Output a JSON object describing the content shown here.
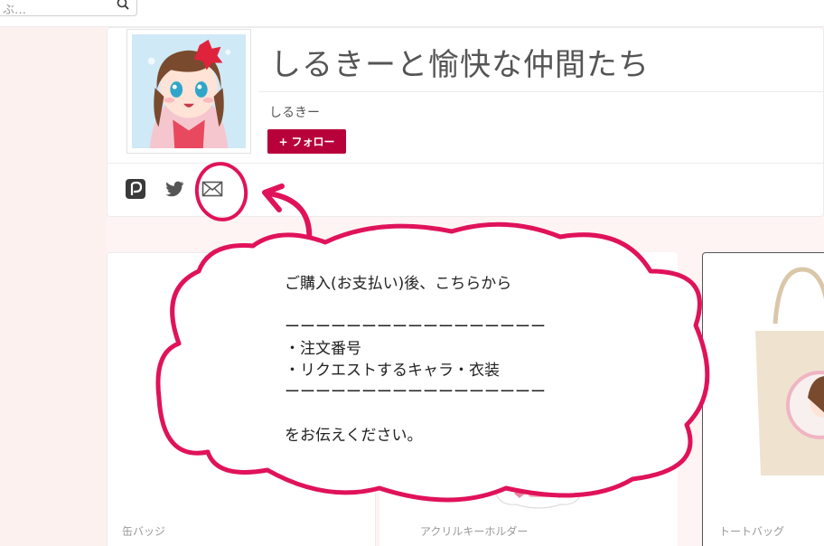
{
  "search": {
    "placeholder": "ぶ…"
  },
  "profile": {
    "shop_title": "しるきーと愉快な仲間たち",
    "owner_name": "しるきー",
    "follow_plus": "+",
    "follow_label": "フォロー"
  },
  "social": {
    "icons": [
      "pixiv-icon",
      "twitter-icon",
      "mail-icon"
    ]
  },
  "callout": {
    "lines": [
      "ご購入(お支払い)後、こちらから",
      "",
      "ーーーーーーーーーーーーーーーーー",
      "・注文番号",
      "・リクエストするキャラ・衣装",
      "ーーーーーーーーーーーーーーーーー",
      "",
      "をお伝えください。"
    ]
  },
  "products": [
    {
      "label": "缶バッジ"
    },
    {
      "label": "アクリルキーホルダー"
    },
    {
      "label": "トートバッグ"
    }
  ],
  "colors": {
    "accent": "#b8003b",
    "annotation": "#e0125a",
    "background": "#fdf4f3"
  }
}
